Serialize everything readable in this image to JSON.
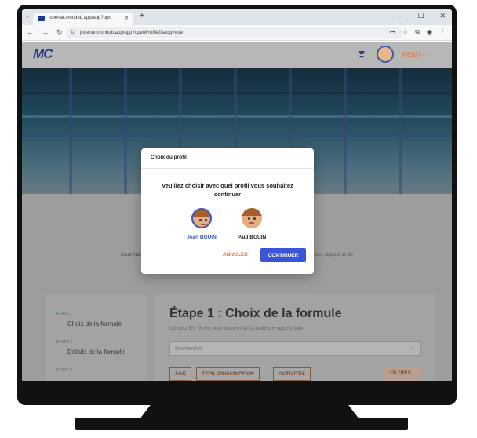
{
  "browser": {
    "tab_title": "jouenat.mondub.app/app?opn",
    "url": "jouenat.mondub.app/app?openProfileDialog=true"
  },
  "site": {
    "logo": "MC",
    "menu_label": "MENU ≡"
  },
  "mission": {
    "line1": "Joué Natation a pour mission de faire découvrir, pratiquer et progresser chacun selon son objectif et de",
    "line2": "promouvoir la natation sur le territoire."
  },
  "steps": [
    {
      "label": "ÉTAPE 1",
      "title": "Choix de la formule"
    },
    {
      "label": "ÉTAPE 2",
      "title": "Détails de la formule"
    },
    {
      "label": "ÉTAPE 3",
      "title": ""
    }
  ],
  "main": {
    "heading": "Étape 1 : Choix de la formule",
    "subheading": "Utilisez les filtres pour trouver la formule de votre choix",
    "search_placeholder": "Rechercher",
    "filters": [
      "ÂGE",
      "TYPE D'INSCRIPTION",
      "ACTIVITÉS"
    ],
    "filter_button": "FILTRES"
  },
  "modal": {
    "title": "Choix du profil",
    "question": "Veuillez choisir avec quel profil vous souhaitez continuer",
    "profiles": [
      {
        "name": "Jean BOUIN",
        "selected": true,
        "color": "#3a56c4"
      },
      {
        "name": "Paul BOUIN",
        "selected": false,
        "color": "#222222"
      }
    ],
    "cancel_label": "ANNULER",
    "continue_label": "CONTINUER"
  },
  "colors": {
    "accent_blue": "#3a56d6",
    "accent_orange": "#d57b47"
  }
}
